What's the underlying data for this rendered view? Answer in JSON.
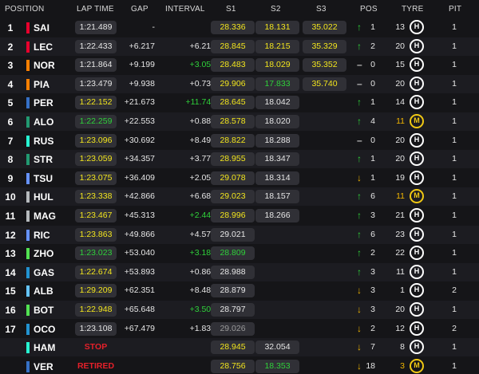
{
  "headers": {
    "position": "POSITION",
    "lap_time": "LAP TIME",
    "gap": "GAP",
    "interval": "INTERVAL",
    "s1": "S1",
    "s2": "S2",
    "s3": "S3",
    "pos": "POS",
    "tyre": "TYRE",
    "pit": "PIT"
  },
  "colors": {
    "fastest": "#2fd13a",
    "personal": "#f2e51d",
    "normal": "#e6e6e6",
    "slow": "#9a9a9a",
    "status": "#e5202a",
    "gain": "#2fd13a",
    "loss": "#f0b400",
    "medium_tyre": "#f0c814",
    "hard_tyre": "#ffffff"
  },
  "rows": [
    {
      "pos": "1",
      "driver": "SAI",
      "team_color": "#e8002d",
      "lap": "1:21.489",
      "lap_color": "white",
      "status": "",
      "gap": "-",
      "gap_color": "white",
      "interval": "-",
      "int_color": "white",
      "s1": "28.336",
      "s1_color": "yellow",
      "s2": "18.131",
      "s2_color": "yellow",
      "s3": "35.022",
      "s3_color": "yellow",
      "dir": "up",
      "change": "1",
      "tyre_laps": "13",
      "tyre_laps_color": "white",
      "tyre": "H",
      "pit": "1"
    },
    {
      "pos": "2",
      "driver": "LEC",
      "team_color": "#e8002d",
      "lap": "1:22.433",
      "lap_color": "white",
      "status": "",
      "gap": "+6.217",
      "gap_color": "white",
      "interval": "+6.217",
      "int_color": "white",
      "s1": "28.845",
      "s1_color": "yellow",
      "s2": "18.215",
      "s2_color": "yellow",
      "s3": "35.329",
      "s3_color": "yellow",
      "dir": "up",
      "change": "2",
      "tyre_laps": "20",
      "tyre_laps_color": "white",
      "tyre": "H",
      "pit": "1"
    },
    {
      "pos": "3",
      "driver": "NOR",
      "team_color": "#ff8000",
      "lap": "1:21.864",
      "lap_color": "white",
      "status": "",
      "gap": "+9.199",
      "gap_color": "white",
      "interval": "+3.052",
      "int_color": "green",
      "s1": "28.483",
      "s1_color": "yellow",
      "s2": "18.029",
      "s2_color": "yellow",
      "s3": "35.352",
      "s3_color": "yellow",
      "dir": "same",
      "change": "0",
      "tyre_laps": "15",
      "tyre_laps_color": "white",
      "tyre": "H",
      "pit": "1"
    },
    {
      "pos": "4",
      "driver": "PIA",
      "team_color": "#ff8000",
      "lap": "1:23.479",
      "lap_color": "white",
      "status": "",
      "gap": "+9.938",
      "gap_color": "white",
      "interval": "+0.739",
      "int_color": "white",
      "s1": "29.906",
      "s1_color": "yellow",
      "s2": "17.833",
      "s2_color": "green",
      "s3": "35.740",
      "s3_color": "yellow",
      "dir": "same",
      "change": "0",
      "tyre_laps": "20",
      "tyre_laps_color": "white",
      "tyre": "H",
      "pit": "1"
    },
    {
      "pos": "5",
      "driver": "PER",
      "team_color": "#3671c6",
      "lap": "1:22.152",
      "lap_color": "yellow",
      "status": "",
      "gap": "+21.673",
      "gap_color": "white",
      "interval": "+11.747",
      "int_color": "green",
      "s1": "28.645",
      "s1_color": "yellow",
      "s2": "18.042",
      "s2_color": "white",
      "s3": "",
      "s3_color": "white",
      "dir": "up",
      "change": "1",
      "tyre_laps": "14",
      "tyre_laps_color": "white",
      "tyre": "H",
      "pit": "1"
    },
    {
      "pos": "6",
      "driver": "ALO",
      "team_color": "#229971",
      "lap": "1:22.259",
      "lap_color": "green",
      "status": "",
      "gap": "+22.553",
      "gap_color": "white",
      "interval": "+0.880",
      "int_color": "white",
      "s1": "28.578",
      "s1_color": "yellow",
      "s2": "18.020",
      "s2_color": "white",
      "s3": "",
      "s3_color": "white",
      "dir": "up",
      "change": "4",
      "tyre_laps": "11",
      "tyre_laps_color": "orange",
      "tyre": "M",
      "pit": "1"
    },
    {
      "pos": "7",
      "driver": "RUS",
      "team_color": "#27f4d2",
      "lap": "1:23.096",
      "lap_color": "yellow",
      "status": "",
      "gap": "+30.692",
      "gap_color": "white",
      "interval": "+8.497",
      "int_color": "white",
      "s1": "28.822",
      "s1_color": "yellow",
      "s2": "18.288",
      "s2_color": "white",
      "s3": "",
      "s3_color": "white",
      "dir": "same",
      "change": "0",
      "tyre_laps": "20",
      "tyre_laps_color": "white",
      "tyre": "H",
      "pit": "1"
    },
    {
      "pos": "8",
      "driver": "STR",
      "team_color": "#229971",
      "lap": "1:23.059",
      "lap_color": "yellow",
      "status": "",
      "gap": "+34.357",
      "gap_color": "white",
      "interval": "+3.774",
      "int_color": "white",
      "s1": "28.955",
      "s1_color": "yellow",
      "s2": "18.347",
      "s2_color": "white",
      "s3": "",
      "s3_color": "white",
      "dir": "up",
      "change": "1",
      "tyre_laps": "20",
      "tyre_laps_color": "white",
      "tyre": "H",
      "pit": "1"
    },
    {
      "pos": "9",
      "driver": "TSU",
      "team_color": "#6692ff",
      "lap": "1:23.075",
      "lap_color": "yellow",
      "status": "",
      "gap": "+36.409",
      "gap_color": "white",
      "interval": "+2.052",
      "int_color": "white",
      "s1": "29.078",
      "s1_color": "yellow",
      "s2": "18.314",
      "s2_color": "white",
      "s3": "",
      "s3_color": "white",
      "dir": "down",
      "change": "1",
      "tyre_laps": "19",
      "tyre_laps_color": "white",
      "tyre": "H",
      "pit": "1"
    },
    {
      "pos": "10",
      "driver": "HUL",
      "team_color": "#b6babd",
      "lap": "1:23.338",
      "lap_color": "yellow",
      "status": "",
      "gap": "+42.866",
      "gap_color": "white",
      "interval": "+6.686",
      "int_color": "white",
      "s1": "29.023",
      "s1_color": "yellow",
      "s2": "18.157",
      "s2_color": "white",
      "s3": "",
      "s3_color": "white",
      "dir": "up",
      "change": "6",
      "tyre_laps": "11",
      "tyre_laps_color": "orange",
      "tyre": "M",
      "pit": "1"
    },
    {
      "pos": "11",
      "driver": "MAG",
      "team_color": "#b6babd",
      "lap": "1:23.467",
      "lap_color": "yellow",
      "status": "",
      "gap": "+45.313",
      "gap_color": "white",
      "interval": "+2.447",
      "int_color": "green",
      "s1": "28.996",
      "s1_color": "yellow",
      "s2": "18.266",
      "s2_color": "white",
      "s3": "",
      "s3_color": "white",
      "dir": "up",
      "change": "3",
      "tyre_laps": "21",
      "tyre_laps_color": "white",
      "tyre": "H",
      "pit": "1"
    },
    {
      "pos": "12",
      "driver": "RIC",
      "team_color": "#6692ff",
      "lap": "1:23.863",
      "lap_color": "yellow",
      "status": "",
      "gap": "+49.866",
      "gap_color": "white",
      "interval": "+4.573",
      "int_color": "white",
      "s1": "29.021",
      "s1_color": "white",
      "s2": "",
      "s2_color": "white",
      "s3": "",
      "s3_color": "white",
      "dir": "up",
      "change": "6",
      "tyre_laps": "23",
      "tyre_laps_color": "white",
      "tyre": "H",
      "pit": "1"
    },
    {
      "pos": "13",
      "driver": "ZHO",
      "team_color": "#52e252",
      "lap": "1:23.023",
      "lap_color": "green",
      "status": "",
      "gap": "+53.040",
      "gap_color": "white",
      "interval": "+3.189",
      "int_color": "green",
      "s1": "28.809",
      "s1_color": "green",
      "s2": "",
      "s2_color": "white",
      "s3": "",
      "s3_color": "white",
      "dir": "up",
      "change": "2",
      "tyre_laps": "22",
      "tyre_laps_color": "white",
      "tyre": "H",
      "pit": "1"
    },
    {
      "pos": "14",
      "driver": "GAS",
      "team_color": "#2293d1",
      "lap": "1:22.674",
      "lap_color": "yellow",
      "status": "",
      "gap": "+53.893",
      "gap_color": "white",
      "interval": "+0.864",
      "int_color": "white",
      "s1": "28.988",
      "s1_color": "white",
      "s2": "",
      "s2_color": "white",
      "s3": "",
      "s3_color": "white",
      "dir": "up",
      "change": "3",
      "tyre_laps": "11",
      "tyre_laps_color": "white",
      "tyre": "H",
      "pit": "1"
    },
    {
      "pos": "15",
      "driver": "ALB",
      "team_color": "#64c4ff",
      "lap": "1:29.209",
      "lap_color": "yellow",
      "status": "",
      "gap": "+62.351",
      "gap_color": "white",
      "interval": "+8.482",
      "int_color": "white",
      "s1": "28.879",
      "s1_color": "white",
      "s2": "",
      "s2_color": "white",
      "s3": "",
      "s3_color": "white",
      "dir": "down",
      "change": "3",
      "tyre_laps": "1",
      "tyre_laps_color": "white",
      "tyre": "H",
      "pit": "2"
    },
    {
      "pos": "16",
      "driver": "BOT",
      "team_color": "#52e252",
      "lap": "1:22.948",
      "lap_color": "yellow",
      "status": "",
      "gap": "+65.648",
      "gap_color": "white",
      "interval": "+3.502",
      "int_color": "green",
      "s1": "28.797",
      "s1_color": "white",
      "s2": "",
      "s2_color": "white",
      "s3": "",
      "s3_color": "white",
      "dir": "down",
      "change": "3",
      "tyre_laps": "20",
      "tyre_laps_color": "white",
      "tyre": "H",
      "pit": "1"
    },
    {
      "pos": "17",
      "driver": "OCO",
      "team_color": "#2293d1",
      "lap": "1:23.108",
      "lap_color": "white",
      "status": "",
      "gap": "+67.479",
      "gap_color": "white",
      "interval": "+1.831",
      "int_color": "white",
      "s1": "29.026",
      "s1_color": "gray",
      "s2": "",
      "s2_color": "white",
      "s3": "",
      "s3_color": "white",
      "dir": "down",
      "change": "2",
      "tyre_laps": "12",
      "tyre_laps_color": "white",
      "tyre": "H",
      "pit": "2"
    },
    {
      "pos": "",
      "driver": "HAM",
      "team_color": "#27f4d2",
      "lap": "",
      "lap_color": "white",
      "status": "STOP",
      "gap": "",
      "gap_color": "white",
      "interval": "",
      "int_color": "white",
      "s1": "28.945",
      "s1_color": "yellow",
      "s2": "32.054",
      "s2_color": "white",
      "s3": "",
      "s3_color": "white",
      "dir": "down",
      "change": "7",
      "tyre_laps": "8",
      "tyre_laps_color": "white",
      "tyre": "H",
      "pit": "1"
    },
    {
      "pos": "",
      "driver": "VER",
      "team_color": "#3671c6",
      "lap": "",
      "lap_color": "white",
      "status": "RETIRED",
      "gap": "",
      "gap_color": "white",
      "interval": "",
      "int_color": "white",
      "s1": "28.756",
      "s1_color": "yellow",
      "s2": "18.353",
      "s2_color": "green",
      "s3": "",
      "s3_color": "white",
      "dir": "down",
      "change": "18",
      "tyre_laps": "3",
      "tyre_laps_color": "orange",
      "tyre": "M",
      "pit": "1"
    }
  ]
}
